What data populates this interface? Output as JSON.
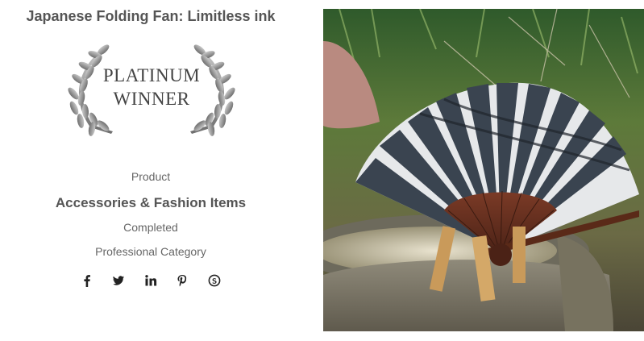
{
  "page": {
    "title": "Japanese Folding Fan: Limitless ink"
  },
  "award": {
    "line1": "PLATINUM",
    "line2": "WINNER",
    "laurel_color": "#9a9a9a"
  },
  "details": {
    "product_label": "Product",
    "category": "Accessories & Fashion Items",
    "status": "Completed",
    "professional_category": "Professional Category"
  },
  "social": [
    {
      "name": "facebook",
      "icon": "facebook-icon"
    },
    {
      "name": "twitter",
      "icon": "twitter-icon"
    },
    {
      "name": "linkedin",
      "icon": "linkedin-icon"
    },
    {
      "name": "pinterest",
      "icon": "pinterest-icon"
    },
    {
      "name": "skype",
      "icon": "skype-icon"
    }
  ],
  "image": {
    "subject": "folding fan photo"
  },
  "colors": {
    "text_dark": "#555555",
    "text_muted": "#666666"
  }
}
